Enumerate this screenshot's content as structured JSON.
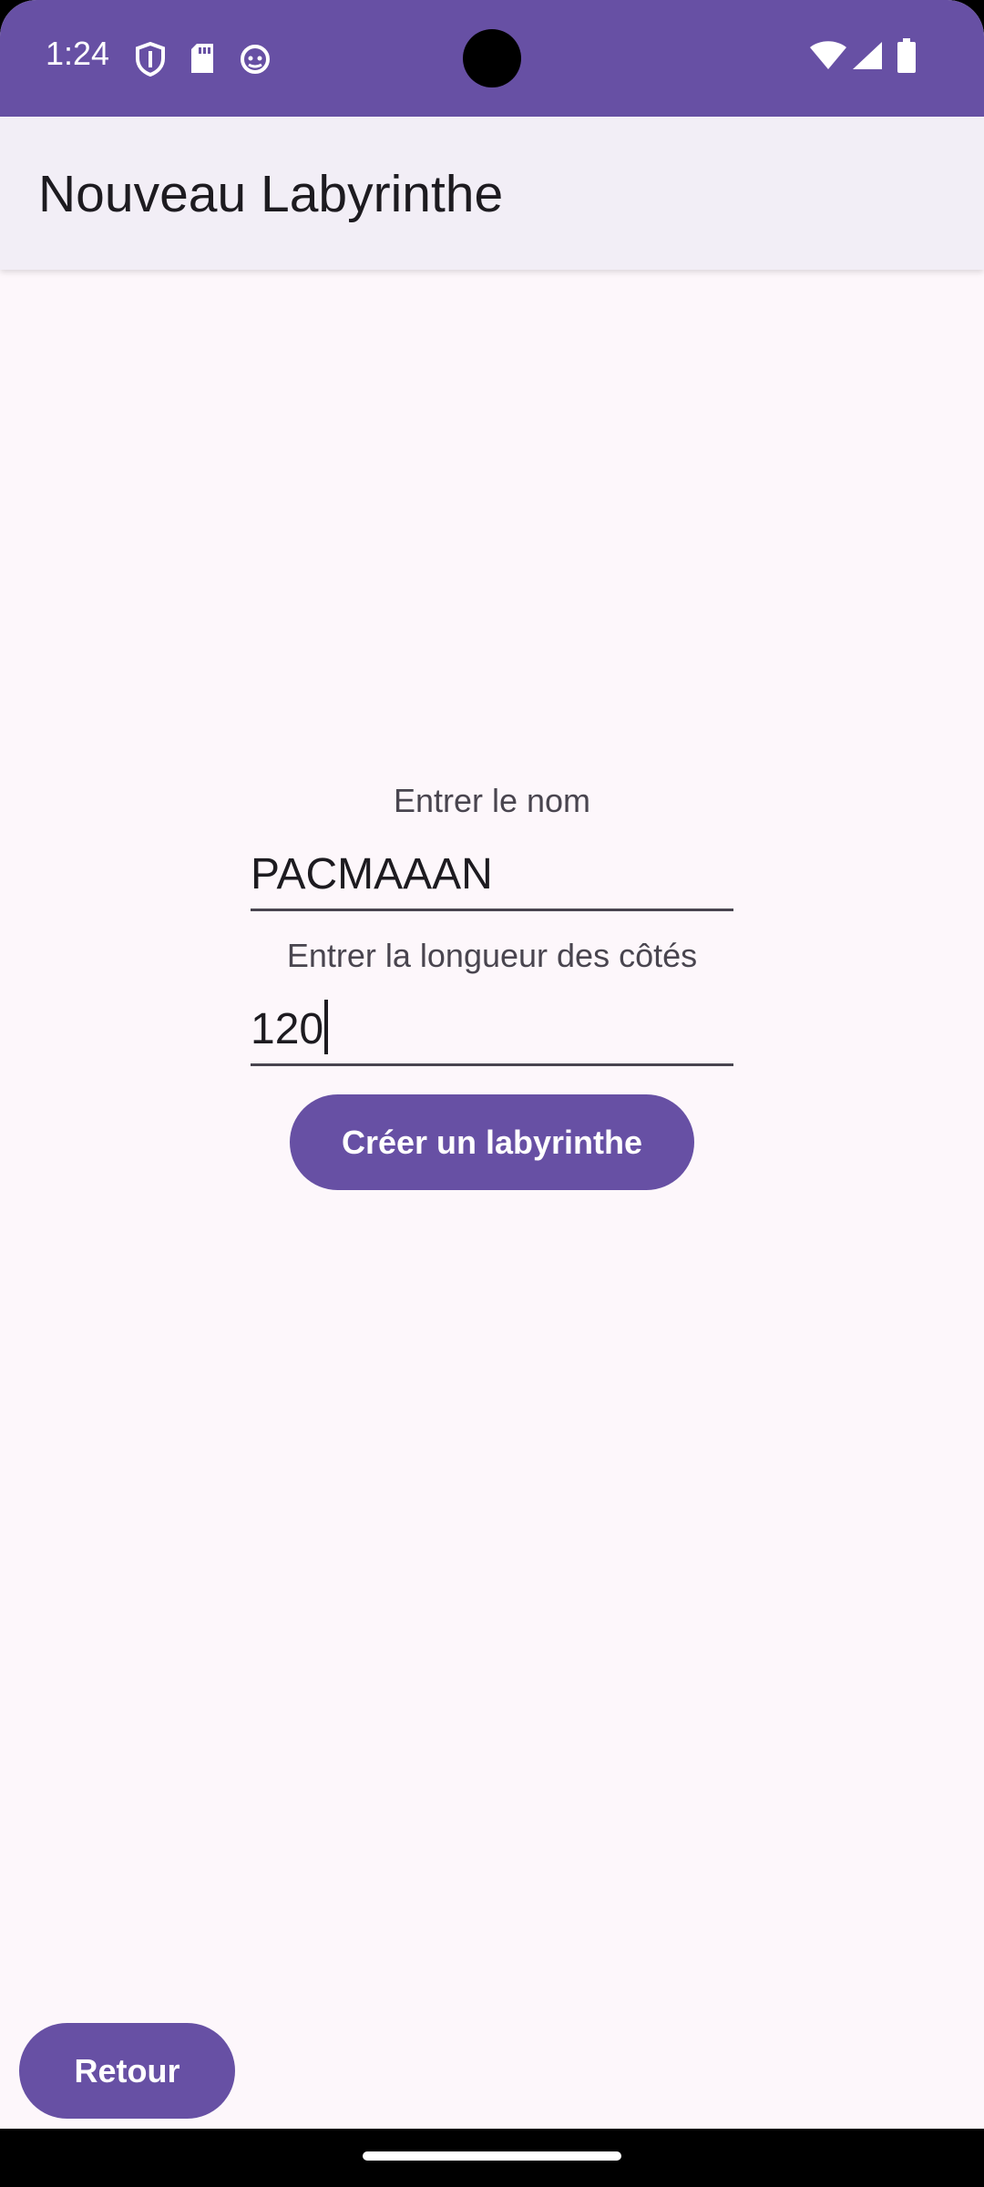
{
  "status_bar": {
    "time": "1:24",
    "left_icons": [
      "shield-icon",
      "sd-card-icon",
      "android-debug-icon"
    ],
    "right_icons": [
      "wifi-icon",
      "cell-signal-icon",
      "battery-icon"
    ]
  },
  "app_bar": {
    "title": "Nouveau Labyrinthe"
  },
  "form": {
    "name_label": "Entrer le nom",
    "name_value": "PACMAAAN",
    "side_label": "Entrer la longueur des côtés",
    "side_value": "120",
    "create_button": "Créer un labyrinthe"
  },
  "footer": {
    "back_button": "Retour"
  },
  "colors": {
    "primary": "#6750a4",
    "background": "#fdf7fb",
    "app_bar": "#f2eef6"
  }
}
